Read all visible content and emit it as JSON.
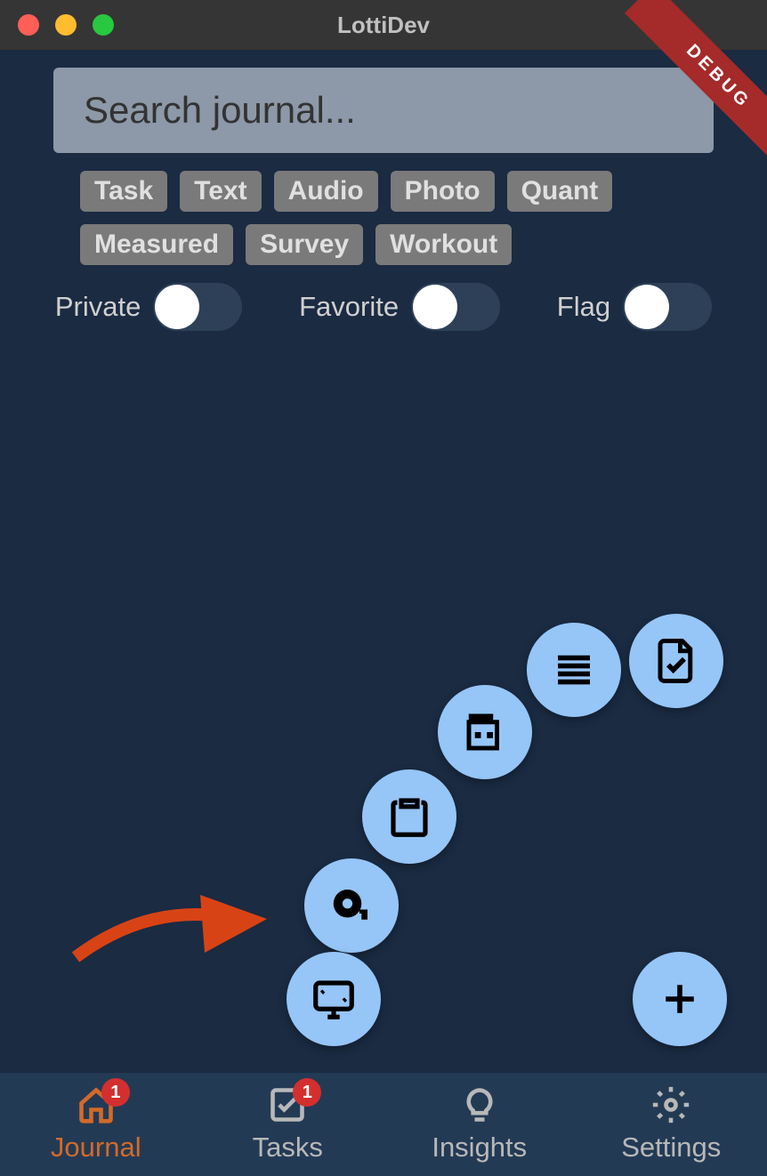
{
  "window": {
    "title": "LottiDev",
    "debug_label": "DEBUG"
  },
  "search": {
    "placeholder": "Search journal..."
  },
  "filter_chips": [
    "Task",
    "Text",
    "Audio",
    "Photo",
    "Quant",
    "Measured",
    "Survey",
    "Workout"
  ],
  "toggles": [
    {
      "label": "Private",
      "on": false
    },
    {
      "label": "Favorite",
      "on": false
    },
    {
      "label": "Flag",
      "on": false
    }
  ],
  "fab": {
    "plus_label": "+",
    "actions": [
      "document-check",
      "text-lines",
      "photo-roll",
      "clipboard",
      "measure-tape",
      "screen"
    ]
  },
  "bottom_nav": {
    "items": [
      {
        "label": "Journal",
        "icon": "home",
        "badge": "1",
        "active": true
      },
      {
        "label": "Tasks",
        "icon": "checkbox",
        "badge": "1",
        "active": false
      },
      {
        "label": "Insights",
        "icon": "lightbulb",
        "badge": null,
        "active": false
      },
      {
        "label": "Settings",
        "icon": "gear",
        "badge": null,
        "active": false
      }
    ]
  }
}
